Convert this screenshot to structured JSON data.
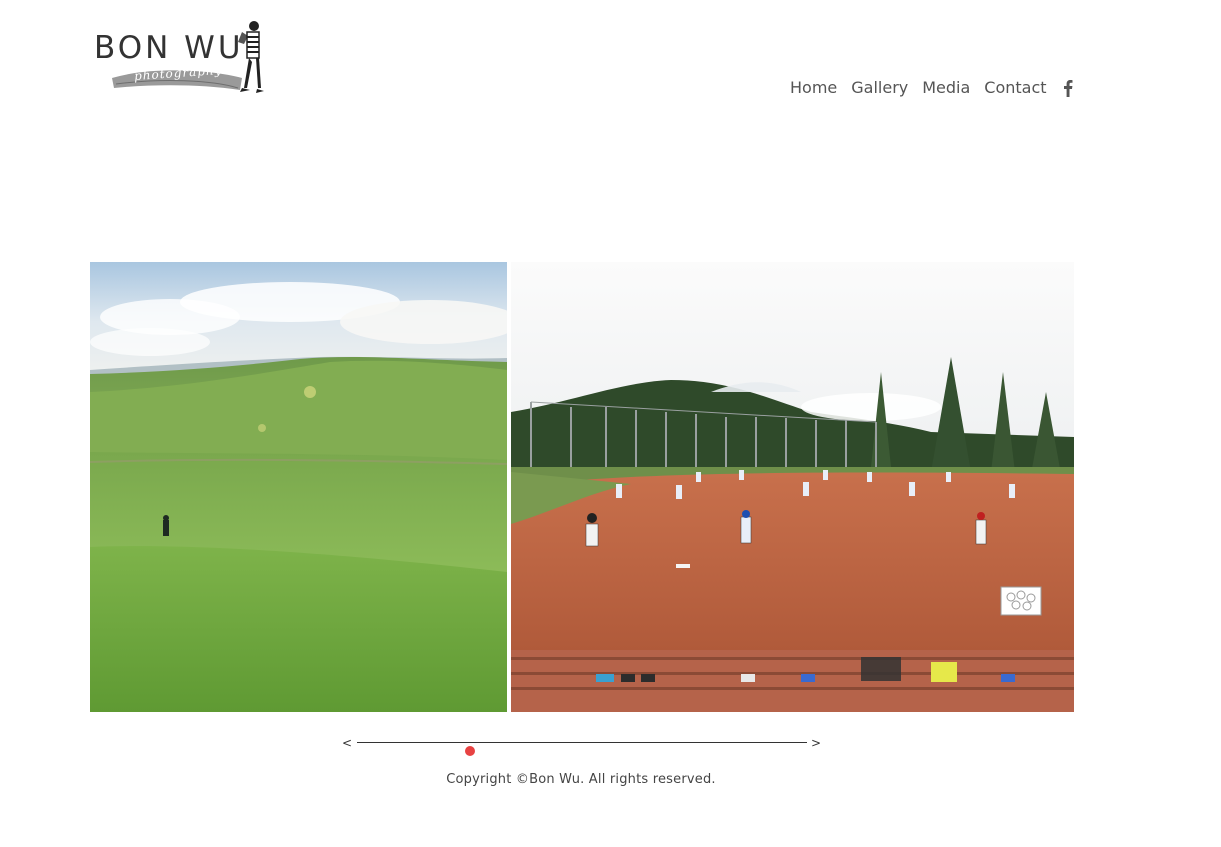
{
  "brand": {
    "name": "BON WU",
    "tagline": "photography",
    "logo_icon": "photographer-figure-icon"
  },
  "nav": {
    "items": [
      {
        "label": "Home"
      },
      {
        "label": "Gallery"
      },
      {
        "label": "Media"
      },
      {
        "label": "Contact"
      }
    ],
    "social_icon": "facebook-icon"
  },
  "gallery": {
    "photos": [
      {
        "name": "green-hills-hiker-photo"
      },
      {
        "name": "baseball-field-practice-photo"
      }
    ]
  },
  "slider": {
    "prev_label": "<",
    "next_label": ">",
    "position": 0.25,
    "accent_color": "#e84242"
  },
  "footer": {
    "copyright": "Copyright ©Bon Wu. All rights reserved."
  }
}
